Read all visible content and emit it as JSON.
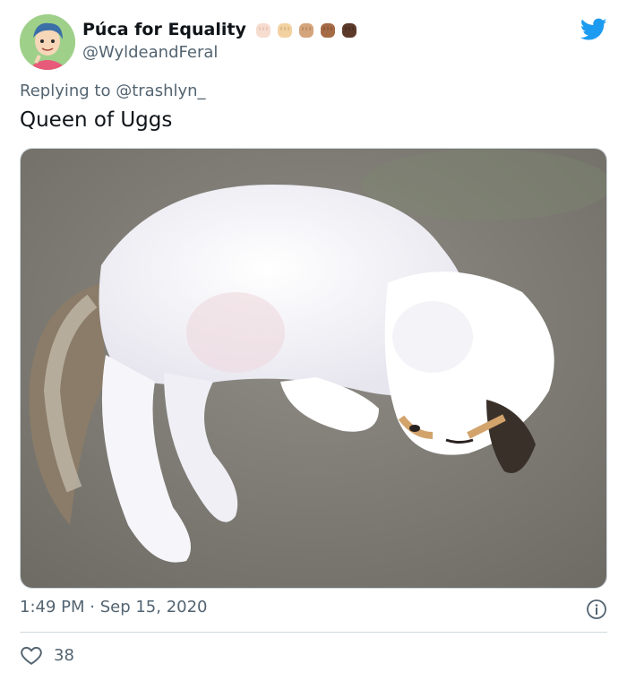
{
  "author": {
    "display_name": "Púca for Equality",
    "handle": "@WyldeandFeral",
    "fist_emojis": [
      "#f7dcd0",
      "#f3d2a2",
      "#d4a47c",
      "#a56b46",
      "#5c3a29"
    ]
  },
  "tweet": {
    "replying_to": "Replying to @trashlyn_",
    "text": "Queen of Uggs",
    "timestamp": "1:49 PM · Sep 15, 2020"
  },
  "engagement": {
    "likes": "38"
  },
  "colors": {
    "twitter_blue": "#1d9bf0",
    "secondary_text": "#536471"
  }
}
